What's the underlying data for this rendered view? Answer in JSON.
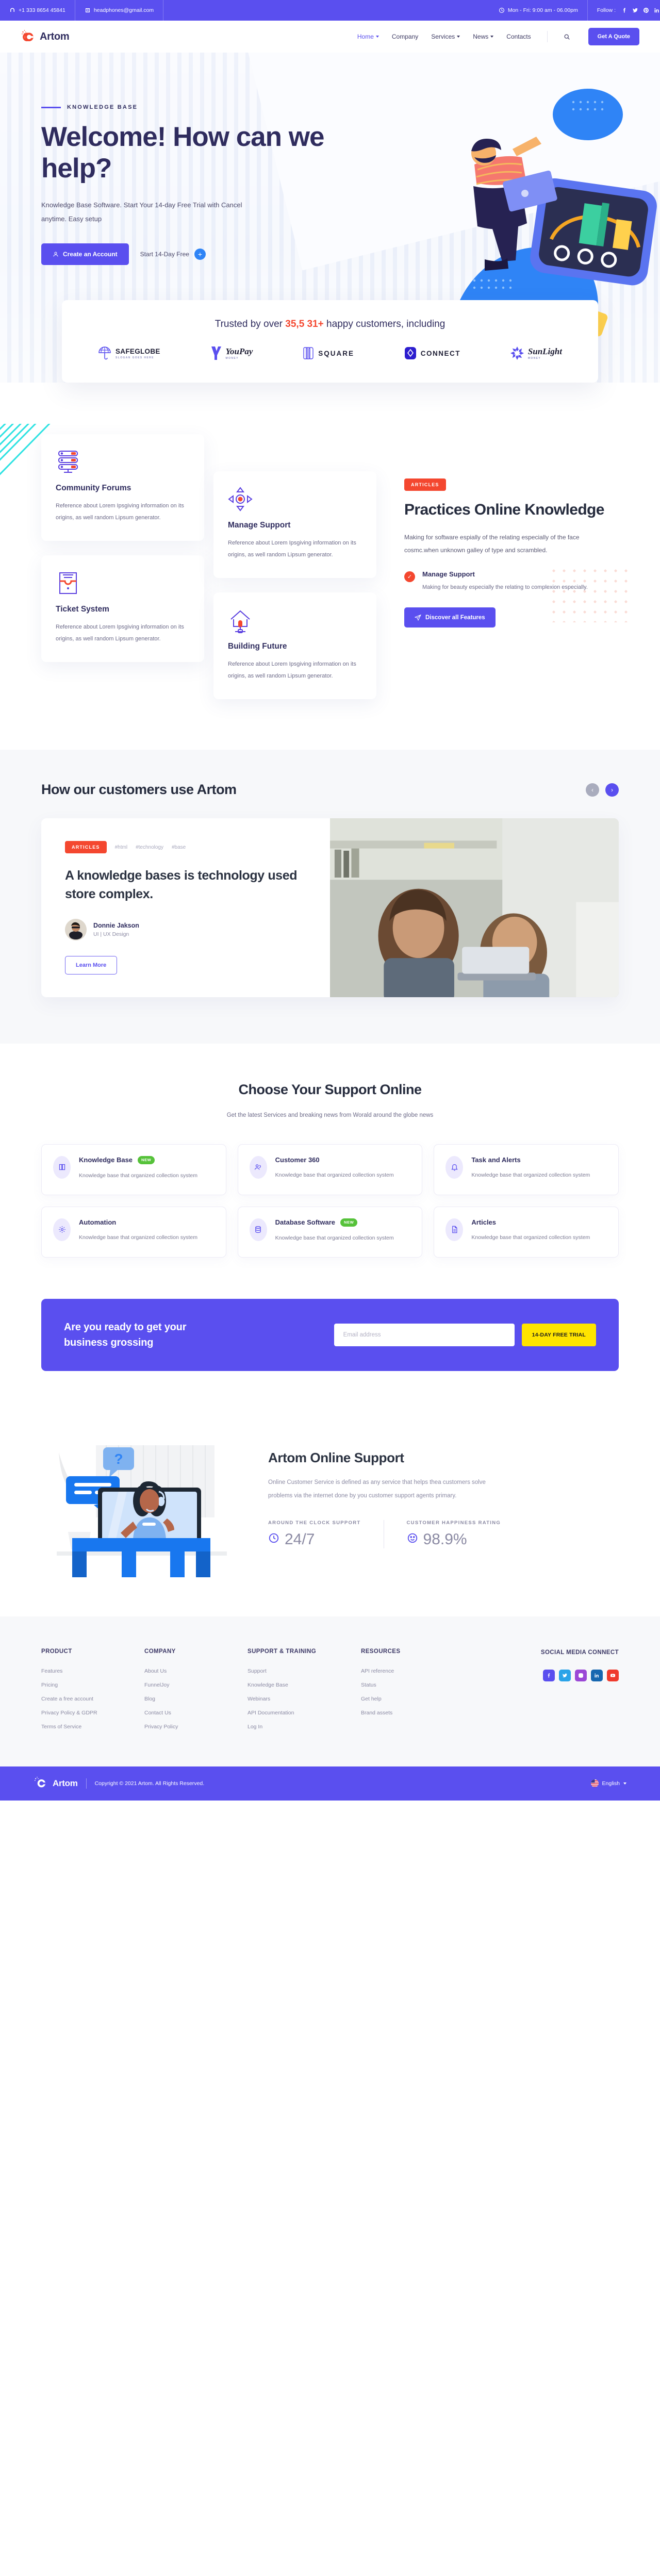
{
  "topbar": {
    "phone": "+1 333 8654 45841",
    "email": "headphones@gmail.com",
    "hours": "Mon - Fri: 9:00 am - 06.00pm",
    "follow_label": "Follow :",
    "socials": [
      "facebook-icon",
      "twitter-icon",
      "pinterest-icon",
      "linkedin-icon"
    ]
  },
  "nav": {
    "brand": "Artom",
    "items": [
      {
        "label": "Home",
        "caret": true,
        "active": true
      },
      {
        "label": "Company",
        "caret": false,
        "active": false
      },
      {
        "label": "Services",
        "caret": true,
        "active": false
      },
      {
        "label": "News",
        "caret": true,
        "active": false
      },
      {
        "label": "Contacts",
        "caret": false,
        "active": false
      }
    ],
    "quote_button": "Get A Quote"
  },
  "hero": {
    "eyebrow": "KNOWLEDGE BASE",
    "title": "Welcome! How can we help?",
    "subtitle": "Knowledge Base Software. Start Your 14-day Free Trial with Cancel anytime. Easy setup",
    "primary_button": "Create an Account",
    "secondary_button": "Start 14-Day Free"
  },
  "trust": {
    "prefix": "Trusted by over ",
    "highlight": "35,5 31+",
    "suffix": " happy customers, including",
    "logos": [
      {
        "name": "SAFEGLOBE",
        "tagline": "SLOGAN GOES HERE"
      },
      {
        "name": "YouPay",
        "tagline": "MONEY"
      },
      {
        "name": "SQUARE",
        "tagline": ""
      },
      {
        "name": "CONNECT",
        "tagline": ""
      },
      {
        "name": "SunLight",
        "tagline": "MONEY"
      }
    ]
  },
  "features": {
    "cards": [
      {
        "title": "Community Forums",
        "text": "Reference about Lorem Ipsgiving information on its origins, as well random Lipsum generator.",
        "icon": "server-rack-icon"
      },
      {
        "title": "Ticket System",
        "text": "Reference about Lorem Ipsgiving information on its origins, as well random Lipsum generator.",
        "icon": "ticket-icon"
      },
      {
        "title": "Manage Support",
        "text": "Reference about Lorem Ipsgiving information on its origins, as well random Lipsum generator.",
        "icon": "move-arrows-icon"
      },
      {
        "title": "Building Future",
        "text": "Reference about Lorem Ipsgiving information on its origins, as well random Lipsum generator.",
        "icon": "house-icon"
      }
    ],
    "practice": {
      "badge": "ARTICLES",
      "title": "Practices Online Knowledge",
      "desc": "Making for software espially of the relating especially of the face cosmc.when unknown galley of type and scrambled.",
      "sub_title": "Manage Support",
      "sub_text": "Making for beauty especially the relating to complexion especially.",
      "button": "Discover all Features"
    }
  },
  "customers": {
    "heading": "How our customers use Artom",
    "prev": "‹",
    "next": "›",
    "card": {
      "badge": "ARTICLES",
      "tags": [
        "#html",
        "#technology",
        "#base"
      ],
      "title": "A knowledge bases is technology used store complex.",
      "author_name": "Donnie Jakson",
      "author_role": "UI | UX Design",
      "button": "Learn More"
    }
  },
  "support": {
    "heading": "Choose Your Support Online",
    "sub": "Get the latest Services and breaking news from Worald around the globe news",
    "cards": [
      {
        "title": "Knowledge Base",
        "badge": "NEW",
        "text": "Knowledge base that organized collection system",
        "icon": "book-icon"
      },
      {
        "title": "Customer 360",
        "badge": "",
        "text": "Knowledge base that organized collection system",
        "icon": "users-icon"
      },
      {
        "title": "Task and Alerts",
        "badge": "",
        "text": "Knowledge base that organized collection system",
        "icon": "bell-icon"
      },
      {
        "title": "Automation",
        "badge": "",
        "text": "Knowledge base that organized collection system",
        "icon": "gear-icon"
      },
      {
        "title": "Database Software",
        "badge": "NEW",
        "text": "Knowledge base that organized collection system",
        "icon": "database-icon"
      },
      {
        "title": "Articles",
        "badge": "",
        "text": "Knowledge base that organized collection system",
        "icon": "file-icon"
      }
    ]
  },
  "cta": {
    "title": "Are you ready to get your business grossing",
    "email_placeholder": "Email address",
    "email_value": "",
    "button": "14-DAY FREE TRIAL"
  },
  "online": {
    "title": "Artom Online Support",
    "desc": "Online Customer Service is defined as any service that helps thea customers solve problems via the internet done by you customer support agents primary.",
    "stats": [
      {
        "label": "AROUND THE CLOCK SUPPORT",
        "value": "24/7",
        "icon": "clock-icon"
      },
      {
        "label": "CUSTOMER HAPPINESS RATING",
        "value": "98.9%",
        "icon": "smile-icon"
      }
    ]
  },
  "footer": {
    "columns": [
      {
        "heading": "PRODUCT",
        "links": [
          "Features",
          "Pricing",
          "Create a free account",
          "Privacy Policy & GDPR",
          "Terms of Service"
        ]
      },
      {
        "heading": "COMPANY",
        "links": [
          "About Us",
          "FunnelJoy",
          "Blog",
          "Contact Us",
          "Privacy Policy"
        ]
      },
      {
        "heading": "SUPPORT & TRAINING",
        "links": [
          "Support",
          "Knowledge Base",
          "Webinars",
          "API Documentation",
          "Log In"
        ]
      },
      {
        "heading": "RESOURCES",
        "links": [
          "API reference",
          "Status",
          "Get help",
          "Brand assets"
        ]
      }
    ],
    "social_heading": "SOCIAL MEDIA CONNECT",
    "socials": [
      {
        "name": "facebook-icon",
        "color": "#5a4fef"
      },
      {
        "name": "twitter-icon",
        "color": "#2aa3e8"
      },
      {
        "name": "instagram-icon",
        "color": "#9b48d6"
      },
      {
        "name": "linkedin-icon",
        "color": "#1667b0"
      },
      {
        "name": "youtube-icon",
        "color": "#ef3b2d"
      }
    ]
  },
  "bottom": {
    "brand": "Artom",
    "copyright": "Copyright © 2021 Artom. All Rights Reserved.",
    "language": "English"
  }
}
